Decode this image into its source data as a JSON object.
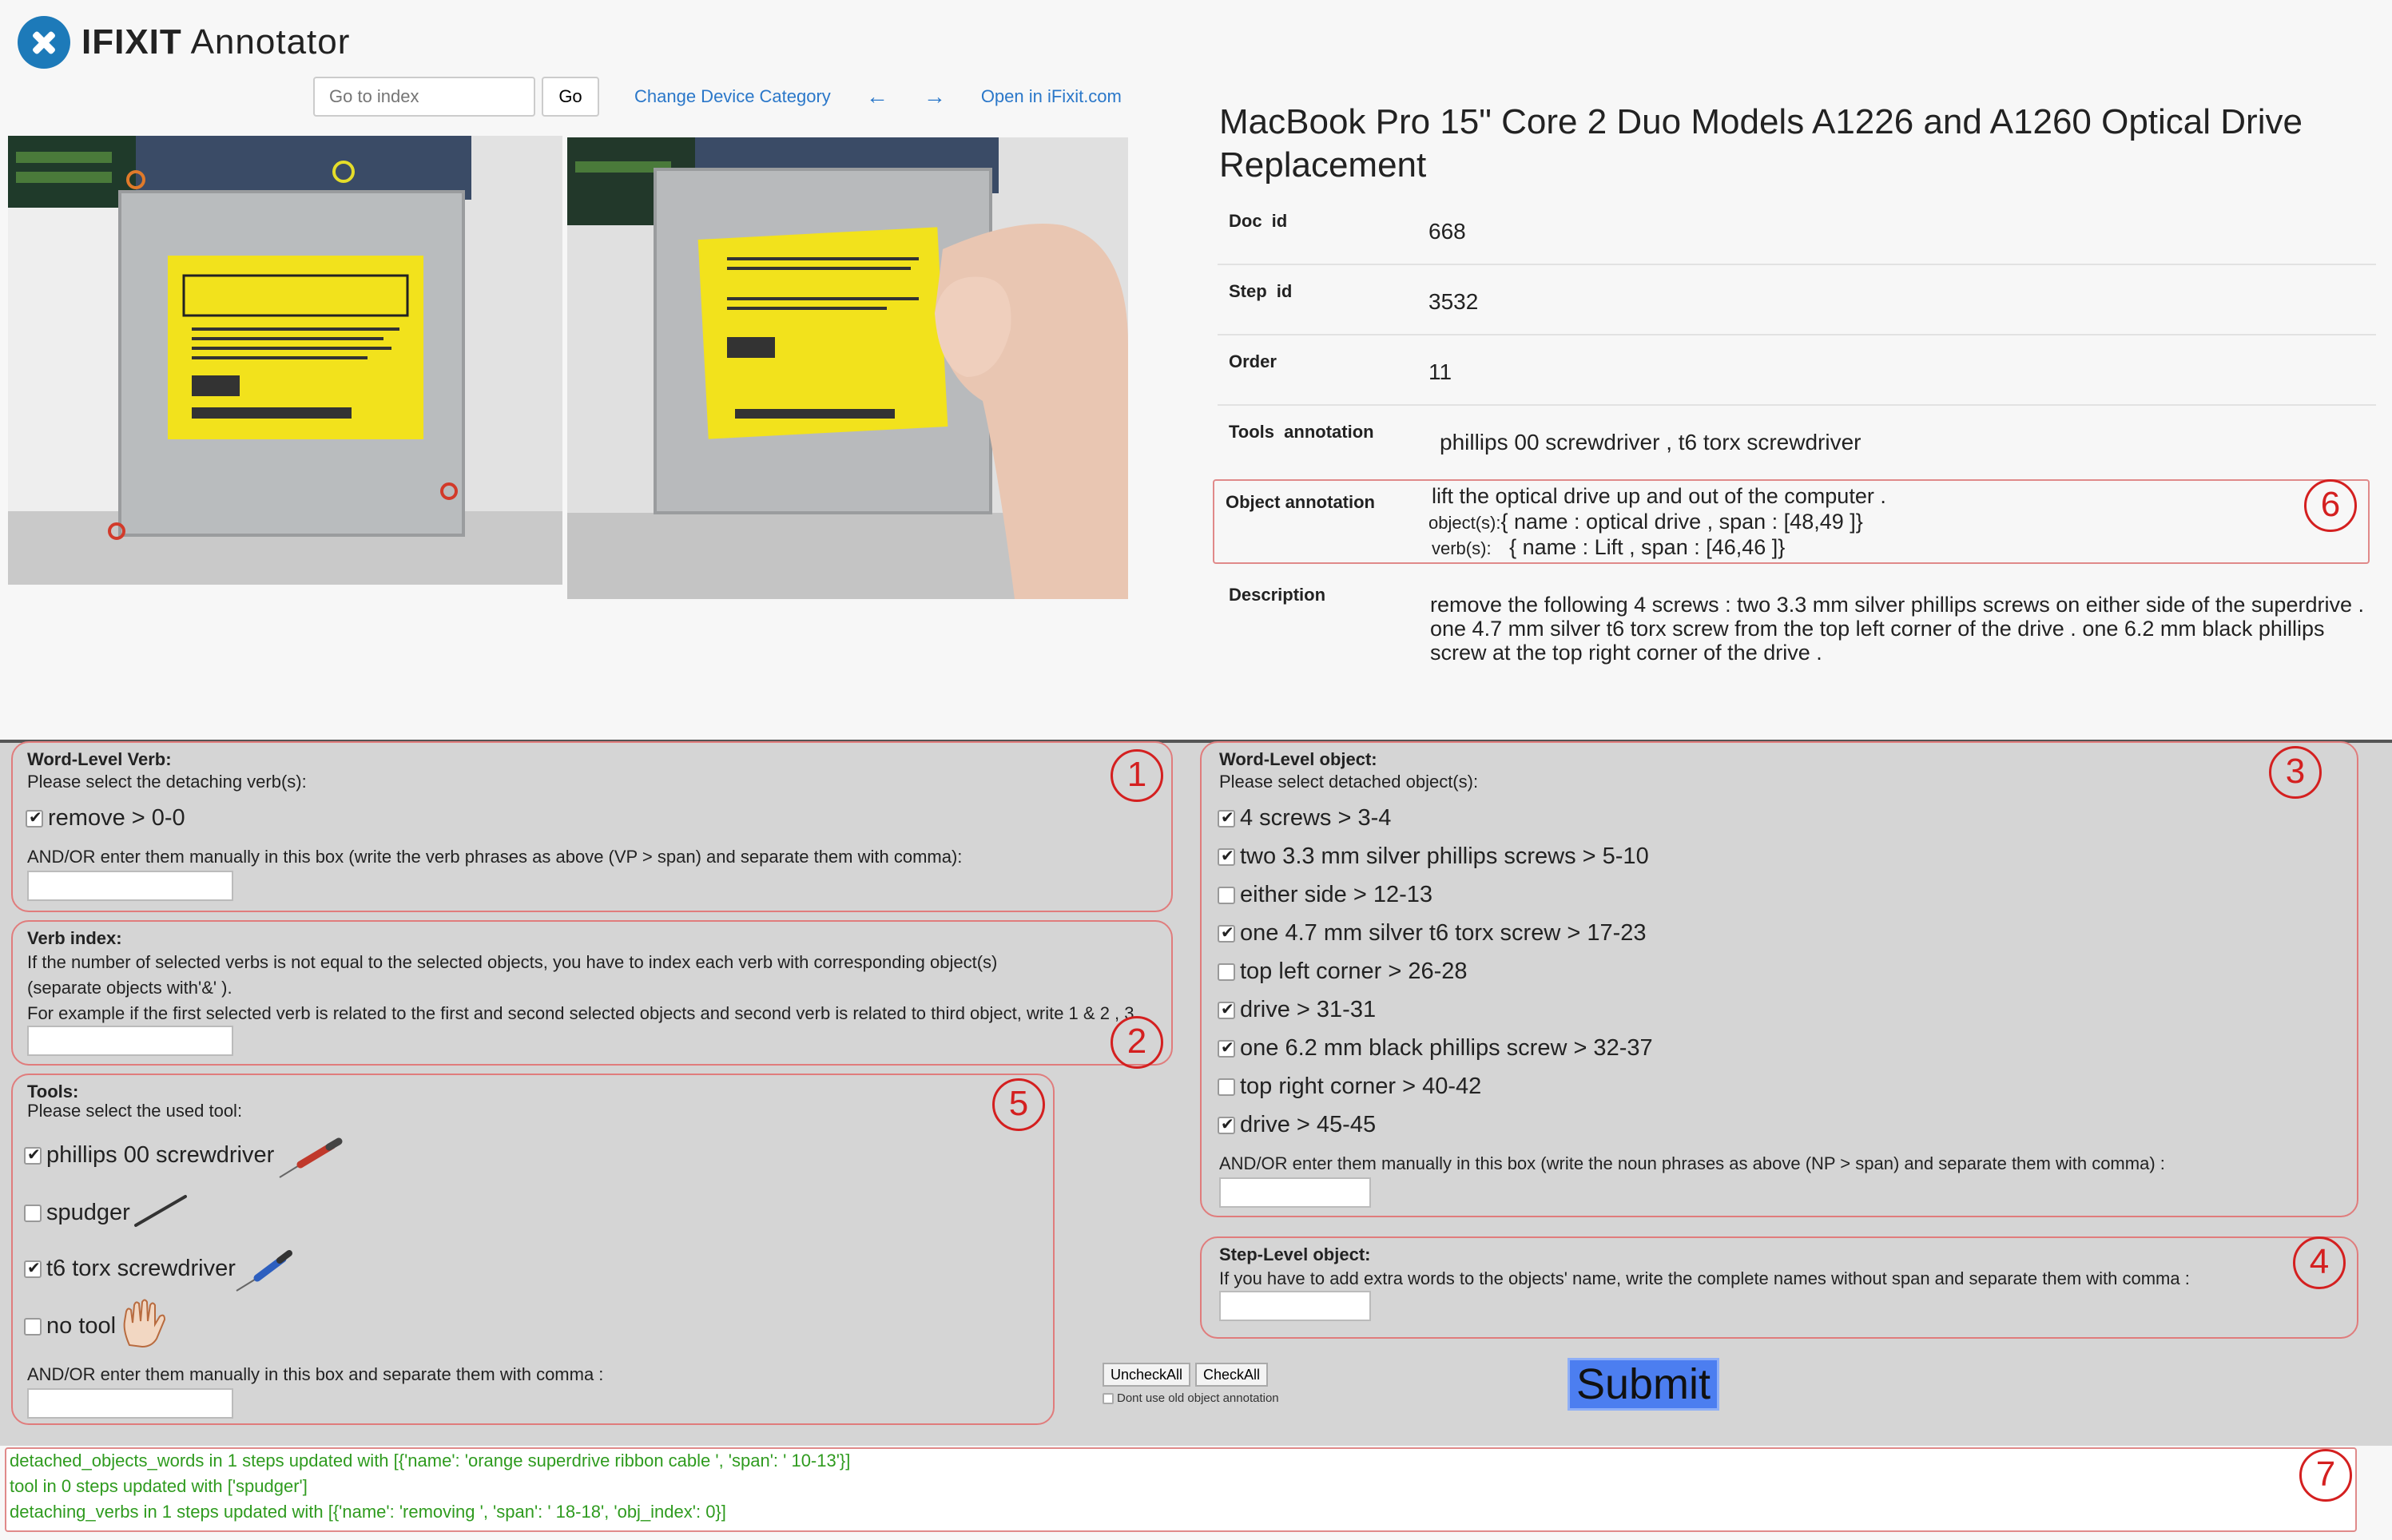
{
  "app": {
    "title_prefix": "IFIXIT",
    "title_suffix": "Annotator"
  },
  "nav": {
    "index_placeholder": "Go to index",
    "go_label": "Go",
    "change_category": "Change Device Category",
    "prev_arrow": "←",
    "next_arrow": "→",
    "open_ifixit": "Open in iFixit.com"
  },
  "doc": {
    "title": "MacBook Pro 15\" Core 2 Duo Models A1226 and A1260 Optical Drive Replacement",
    "rows": [
      {
        "label": "Doc  id",
        "value": "668"
      },
      {
        "label": "Step  id",
        "value": "3532"
      },
      {
        "label": "Order",
        "value": "11"
      },
      {
        "label": "Tools  annotation",
        "value": "phillips 00 screwdriver ,  t6 torx screwdriver"
      }
    ],
    "object_annotation": {
      "label": "Object annotation",
      "sentence": "lift the optical drive up and out of the computer .",
      "objects_prefix": "object(s):",
      "objects_value": "{ name :  optical drive ,  span : [48,49 ]}",
      "verbs_prefix": "verb(s):",
      "verbs_value": "{ name :  Lift ,  span : [46,46 ]}"
    },
    "description_label": "Description",
    "description": "remove the following 4 screws : two 3.3 mm silver phillips screws on either side of the superdrive . one 4.7 mm silver t6 torx screw from the top left corner of the drive . one 6.2 mm black phillips screw at the top right corner of the drive ."
  },
  "markers": [
    "1",
    "2",
    "3",
    "4",
    "5",
    "6",
    "7"
  ],
  "verb_panel": {
    "heading": "Word-Level Verb:",
    "instruction": "Please select the detaching verb(s):",
    "items": [
      {
        "label": "remove > 0-0",
        "checked": true
      }
    ],
    "manual_note": "AND/OR enter them manually in this box (write the verb phrases as above (VP > span) and separate them with comma):"
  },
  "verb_index_panel": {
    "heading": "Verb index:",
    "line1": "If the number of selected verbs is not equal to the selected objects, you have to index each verb with corresponding object(s)",
    "line2": " (separate objects with'&' ).",
    "line3": "For example if the first selected verb is related to the first and second selected objects and second verb is related to third object, write 1 & 2 , 3"
  },
  "tools_panel": {
    "heading": "Tools:",
    "instruction": "Please select the used tool:",
    "items": [
      {
        "label": "phillips 00 screwdriver",
        "checked": true,
        "icon": "screwdriver-icon"
      },
      {
        "label": "spudger",
        "checked": false,
        "icon": "spudger-icon"
      },
      {
        "label": "t6 torx screwdriver",
        "checked": true,
        "icon": "torx-screwdriver-icon"
      },
      {
        "label": "no tool",
        "checked": false,
        "icon": "hand-icon"
      }
    ],
    "manual_note": "AND/OR enter them manually in this box and separate them with comma :"
  },
  "object_panel": {
    "heading": "Word-Level object:",
    "instruction": "Please select detached object(s):",
    "items": [
      {
        "label": "4 screws > 3-4",
        "checked": true
      },
      {
        "label": "two 3.3 mm silver phillips screws > 5-10",
        "checked": true
      },
      {
        "label": "either side > 12-13",
        "checked": false
      },
      {
        "label": "one 4.7 mm silver t6 torx screw > 17-23",
        "checked": true
      },
      {
        "label": "top left corner > 26-28",
        "checked": false
      },
      {
        "label": "drive > 31-31",
        "checked": true
      },
      {
        "label": "one 6.2 mm black phillips screw > 32-37",
        "checked": true
      },
      {
        "label": "top right corner > 40-42",
        "checked": false
      },
      {
        "label": "drive > 45-45",
        "checked": true
      }
    ],
    "manual_note": "AND/OR enter them manually in this box (write the noun phrases as above (NP > span) and separate them with comma) :"
  },
  "step_object_panel": {
    "heading": "Step-Level object:",
    "instruction": "If you have to add extra words to the objects' name, write the complete names without span and separate them with comma :"
  },
  "actions": {
    "uncheck_all": "UncheckAll",
    "check_all": "CheckAll",
    "dont_use_old": "Dont use old object annotation",
    "submit": "Submit"
  },
  "log": [
    "detached_objects_words in 1 steps updated with [{'name': 'orange superdrive ribbon cable ', 'span': ' 10-13'}]",
    "tool in 0 steps updated with ['spudger']",
    "detaching_verbs in 1 steps updated with [{'name': 'removing ', 'span': ' 18-18', 'obj_index': 0}]"
  ],
  "colors": {
    "link": "#2a77c9",
    "marker": "#d42020",
    "submit": "#4c7ef0",
    "log_text": "#2f9b1f"
  }
}
